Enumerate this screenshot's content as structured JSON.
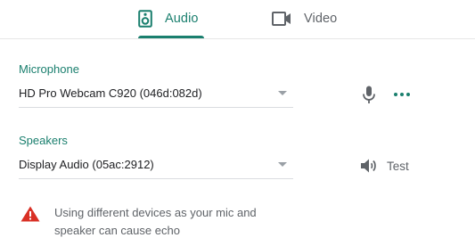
{
  "tabs": [
    {
      "label": "Audio",
      "icon": "speaker-icon",
      "selected": true
    },
    {
      "label": "Video",
      "icon": "video-camera-icon",
      "selected": false
    }
  ],
  "microphone": {
    "label": "Microphone",
    "selected_device": "HD Pro Webcam C920 (046d:082d)",
    "icons": [
      "microphone-icon",
      "more-options-icon"
    ]
  },
  "speakers": {
    "label": "Speakers",
    "selected_device": "Display Audio (05ac:2912)",
    "test_label": "Test",
    "test_icon": "volume-icon"
  },
  "warning": {
    "icon": "warning-icon",
    "text": "Using different devices as your mic and speaker can cause echo"
  },
  "colors": {
    "accent": "#1a7f6e",
    "warning": "#d93025",
    "muted": "#5f6368"
  }
}
